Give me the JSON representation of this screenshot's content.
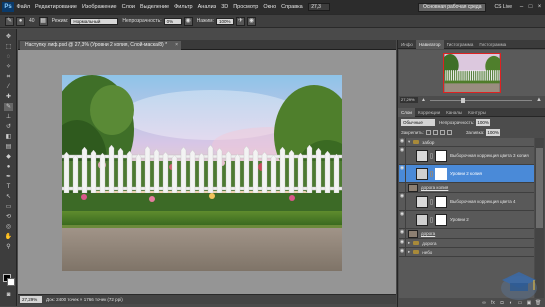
{
  "menubar": {
    "logo": "Ps",
    "items": [
      "Файл",
      "Редактирование",
      "Изображение",
      "Слои",
      "Выделение",
      "Фильтр",
      "Анализ",
      "3D",
      "Просмотр",
      "Окно",
      "Справка"
    ],
    "zoom": "27,3",
    "workspace_button": "Основная рабочая среда",
    "cs_live": "CS Live"
  },
  "options": {
    "brush_size": "40",
    "mode_label": "Режим:",
    "mode_value": "Нормальный",
    "opacity_label": "Непрозрачность:",
    "opacity_value": "0%",
    "pressure_label": "Нажим:",
    "pressure_value": "100%"
  },
  "document": {
    "tab_title": "Наступку лиф.psd @ 27,3% (Уровни 2 копия, Слой-маска/8) *",
    "close": "×",
    "status_zoom": "27,29%",
    "status_info": "Док: 2400 точек × 1766 точек (72 ppi)"
  },
  "navigator": {
    "tabs": [
      "Инфо",
      "Навигатор",
      "Гистограмма",
      "Гистограмма"
    ],
    "active_tab": 1,
    "zoom": "27,29%"
  },
  "layers_panel": {
    "tabs": [
      "Слои",
      "Коррекции",
      "Каналы",
      "Контуры"
    ],
    "active_tab": 0,
    "blend_mode": "Обычные",
    "opacity_label": "Непрозрачность:",
    "opacity_value": "100%",
    "lock_label": "Закрепить:",
    "fill_label": "Заливка:",
    "fill_value": "100%",
    "layers": [
      {
        "name": "забор",
        "type": "group",
        "selected": false
      },
      {
        "name": "Выборочная коррекция цвета 3 копия",
        "type": "adjust",
        "selected": false
      },
      {
        "name": "Уровни 2 копия",
        "type": "adjust",
        "selected": true
      },
      {
        "name": "дорога копия",
        "type": "image-small",
        "selected": false
      },
      {
        "name": "Выборочная коррекция цвета 4",
        "type": "adjust",
        "selected": false
      },
      {
        "name": "Уровни 2",
        "type": "adjust",
        "selected": false
      },
      {
        "name": "дорога",
        "type": "image-small",
        "selected": false
      },
      {
        "name": "дорога",
        "type": "group",
        "selected": false
      },
      {
        "name": "небо",
        "type": "group",
        "selected": false
      }
    ]
  },
  "colors": {
    "selection": "#4a8ad8",
    "canvas_bg": "#959595",
    "menubar_bg": "#2c2c2c"
  }
}
